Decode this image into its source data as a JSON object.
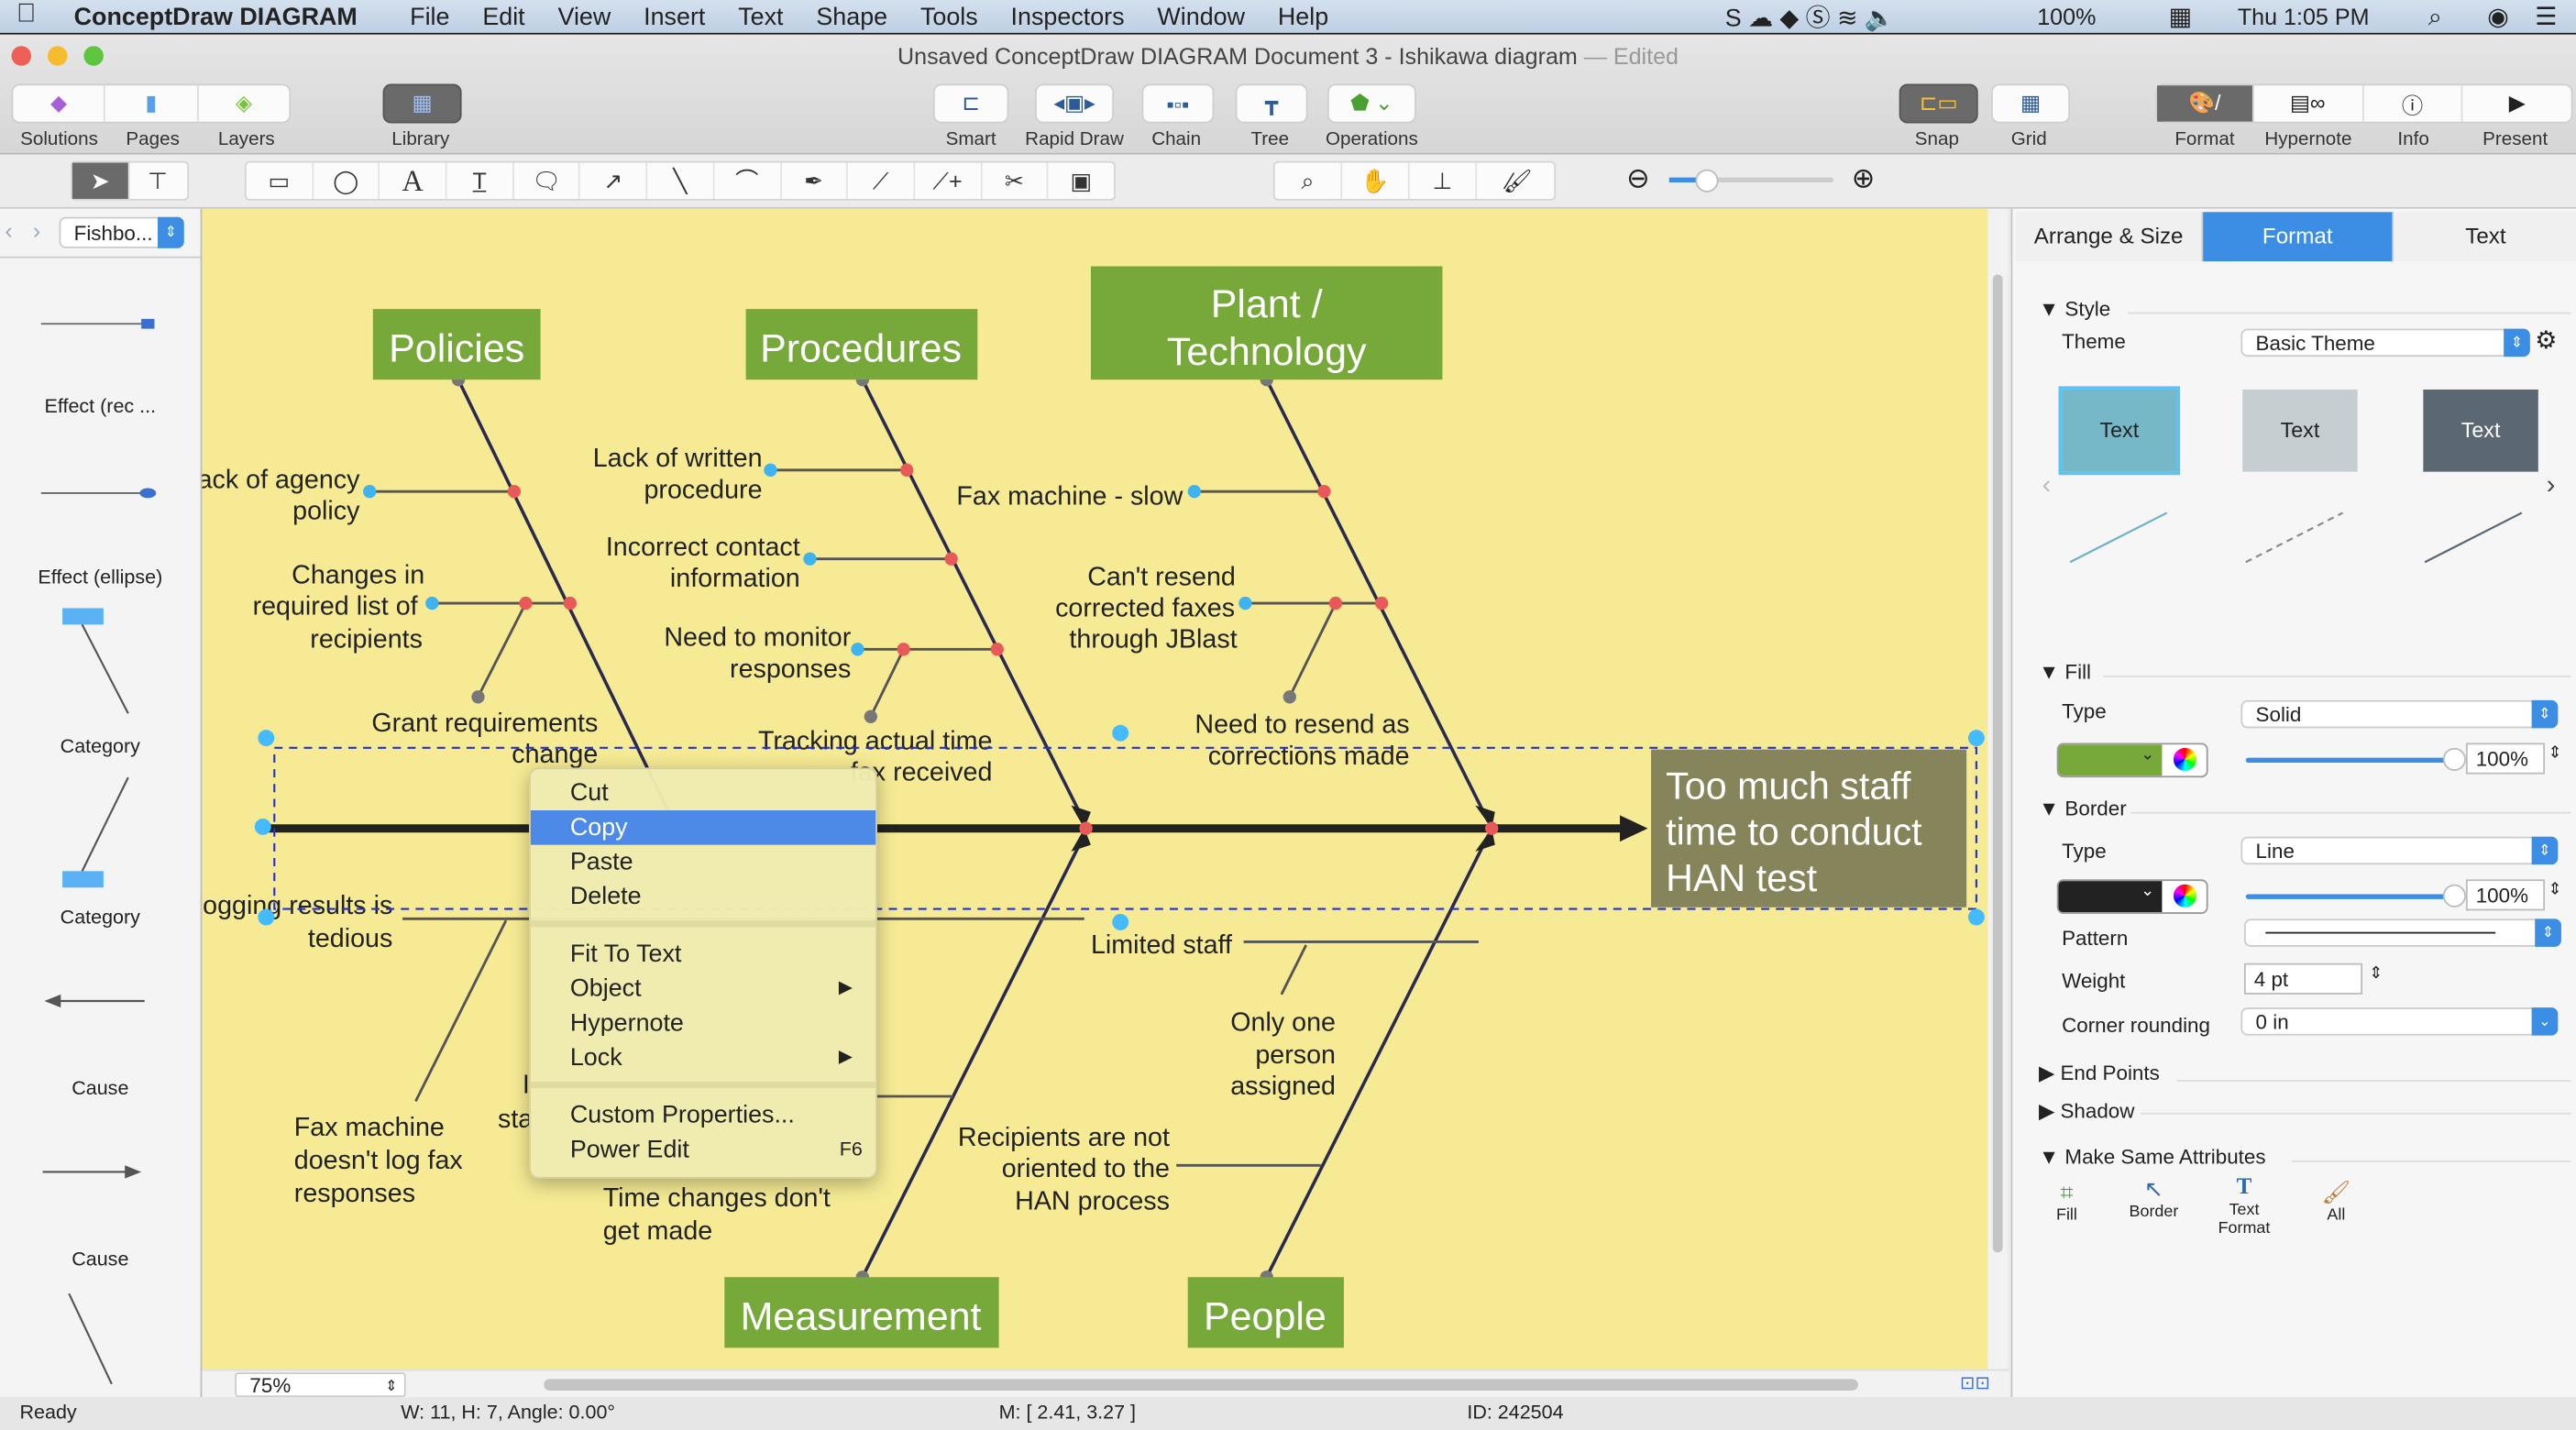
{
  "menubar": {
    "app": "ConceptDraw DIAGRAM",
    "items": [
      "File",
      "Edit",
      "View",
      "Insert",
      "Text",
      "Shape",
      "Tools",
      "Inspectors",
      "Window",
      "Help"
    ],
    "battery": "100%",
    "clock": "Thu 1:05 PM"
  },
  "window": {
    "title": "Unsaved ConceptDraw DIAGRAM Document 3 - Ishikawa diagram",
    "edited": "— Edited"
  },
  "toolbar": {
    "solutions": "Solutions",
    "pages": "Pages",
    "layers": "Layers",
    "library": "Library",
    "smart": "Smart",
    "rapid_draw": "Rapid Draw",
    "chain": "Chain",
    "tree": "Tree",
    "operations": "Operations",
    "snap": "Snap",
    "grid": "Grid",
    "format": "Format",
    "hypernote": "Hypernote",
    "info": "Info",
    "present": "Present"
  },
  "library": {
    "selected": "Fishbo...",
    "items": [
      "Effect (rec ...",
      "Effect (ellipse)",
      "Category",
      "Category",
      "Cause",
      "Cause"
    ],
    "thumb_effect": "Effect",
    "thumb_category": "Category"
  },
  "diagram": {
    "effect": [
      "Too much staff",
      "time to conduct",
      "HAN test"
    ],
    "categories": {
      "policies": "Policies",
      "procedures": "Procedures",
      "plant": [
        "Plant /",
        "Technology"
      ],
      "measurement": "Measurement",
      "people": "People"
    },
    "causes": {
      "lack_agency": [
        "Lack of agency",
        "policy"
      ],
      "changes": [
        "Changes in",
        "required list of",
        "recipients"
      ],
      "grant": [
        "Grant requirements",
        "change"
      ],
      "lack_written": [
        "Lack of written",
        "procedure"
      ],
      "incorrect": [
        "Incorrect contact",
        "information"
      ],
      "monitor": [
        "Need to monitor",
        "responses"
      ],
      "tracking": [
        "Tracking actual time",
        "fax received"
      ],
      "fax_slow": "Fax machine - slow",
      "cant_resend": [
        "Can't resend",
        "corrected faxes",
        "through JBlast"
      ],
      "resend": [
        "Need to resend as",
        "corrections made"
      ],
      "logging": [
        "Logging results is",
        "tedious"
      ],
      "fax_log": [
        "Fax machine",
        "doesn't log fax",
        "responses"
      ],
      "time_changes": [
        "Time changes don't",
        "get made"
      ],
      "limited": "Limited staff",
      "only_one": [
        "Only one",
        "person",
        "assigned"
      ],
      "recipients": [
        "Recipients are not",
        "oriented to the",
        "HAN process"
      ],
      "fragment_1": "I",
      "fragment_2": "sta"
    },
    "colors": {
      "canvas": "#f6eb94",
      "category": "#77a83a",
      "effect": "#85845a",
      "selection": "#2233cc",
      "handle": "#44bbff",
      "cause_dot": "#e85a5a"
    }
  },
  "context_menu": {
    "items": [
      "Cut",
      "Copy",
      "Paste",
      "Delete",
      "Fit To Text",
      "Object",
      "Hypernote",
      "Lock",
      "Custom Properties...",
      "Power Edit"
    ],
    "shortcut": "F6",
    "selected": "Copy"
  },
  "inspector": {
    "tabs": [
      "Arrange & Size",
      "Format",
      "Text"
    ],
    "active_tab": "Format",
    "style": "Style",
    "theme_label": "Theme",
    "theme": "Basic Theme",
    "theme_samples": [
      "Text",
      "Text",
      "Text"
    ],
    "fill": "Fill",
    "fill_type_label": "Type",
    "fill_type": "Solid",
    "fill_color": "#77a83a",
    "fill_opacity": "100%",
    "border": "Border",
    "border_type_label": "Type",
    "border_type": "Line",
    "border_color": "#222222",
    "border_opacity": "100%",
    "pattern_label": "Pattern",
    "weight_label": "Weight",
    "weight": "4 pt",
    "corner_label": "Corner rounding",
    "corner": "0 in",
    "end_points": "End Points",
    "shadow": "Shadow",
    "make_same": "Make Same Attributes",
    "make_same_buttons": [
      "Fill",
      "Border",
      "Text Format",
      "All"
    ]
  },
  "zoom": "75%",
  "status": {
    "state": "Ready",
    "size": "W: 11,  H: 7,  Angle: 0.00°",
    "mouse": "M: [ 2.41, 3.27 ]",
    "id": "ID: 242504"
  }
}
